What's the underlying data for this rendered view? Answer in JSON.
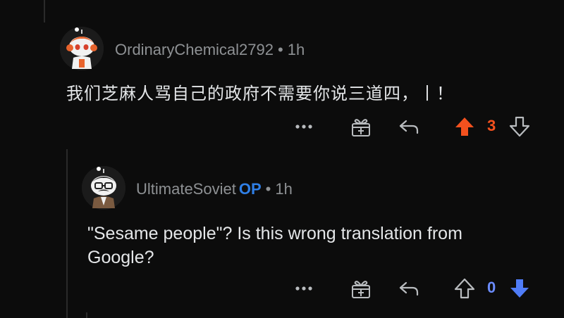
{
  "comments": [
    {
      "author": "OrdinaryChemical2792",
      "time": "1h",
      "body": "我们芝麻人骂自己的政府不需要你说三道四，丨！",
      "votes": "3",
      "vote_state": "upvoted",
      "colors": {
        "vote": "#f4511e"
      }
    },
    {
      "author": "UltimateSoviet",
      "badge": "OP",
      "time": "1h",
      "body_line1": "\"Sesame people\"? Is this wrong translation from",
      "body_line2": "Google?",
      "votes": "0",
      "vote_state": "downvoted",
      "colors": {
        "vote": "#6b8cff"
      }
    }
  ],
  "icons": [
    "more-icon",
    "award-icon",
    "reply-icon",
    "upvote-icon",
    "downvote-icon"
  ]
}
